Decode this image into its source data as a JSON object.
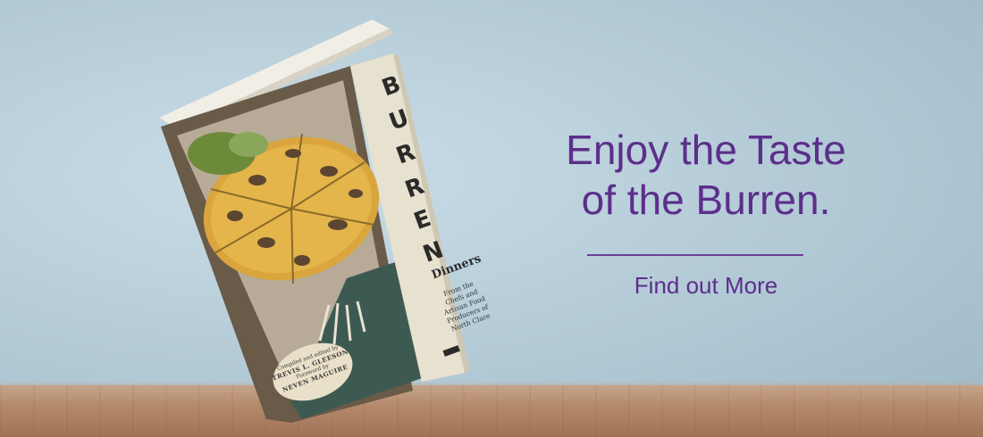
{
  "book": {
    "title_letters": [
      "B",
      "U",
      "R",
      "R",
      "E",
      "N"
    ],
    "subtitle_word": "Dinners",
    "tagline_lines": [
      "From the",
      "Chefs and",
      "Artisan Food",
      "Producers of",
      "North Clare"
    ],
    "badge_lines": [
      "Compiled and edited by",
      "TREVIS L. GLEESON",
      "Foreword by",
      "NEVEN MAGUIRE"
    ]
  },
  "promo": {
    "headline_line1": "Enjoy the Taste",
    "headline_line2": "of the Burren.",
    "cta_label": "Find out More"
  },
  "colors": {
    "accent": "#5c2f8a",
    "background": "#b6cdd9",
    "table": "#b48a6c"
  }
}
